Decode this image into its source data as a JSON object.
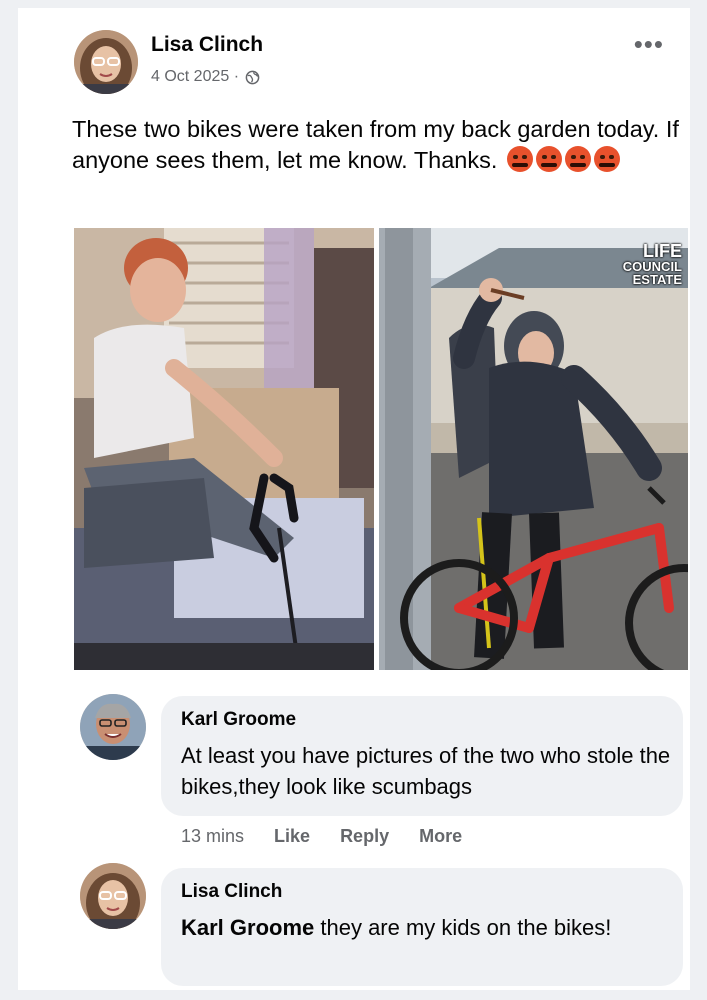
{
  "post": {
    "author": "Lisa Clinch",
    "date": "4 Oct 2025 ·",
    "privacy_icon": "globe-icon",
    "more_icon": "more-options-icon",
    "more_label": "•••",
    "text": "These two bikes were taken from my back garden today. If anyone sees them, let me know. Thanks.",
    "emoji_count": 4
  },
  "photos": {
    "watermark_top": "LIFE",
    "watermark_mid": "COUNCIL",
    "watermark_bot": "ESTATE"
  },
  "comments": [
    {
      "author": "Karl Groome",
      "text": "At least you have pictures of the two who stole the bikes,they look like scumbags",
      "time": "13 mins",
      "like": "Like",
      "reply": "Reply",
      "more": "More"
    },
    {
      "author": "Lisa Clinch",
      "mention": "Karl Groome",
      "text": " they are my kids on the bikes!"
    }
  ],
  "colors": {
    "card": "#ffffff",
    "bubble": "#eff1f4",
    "meta": "#65676b",
    "bike_red": "#d9322e"
  }
}
